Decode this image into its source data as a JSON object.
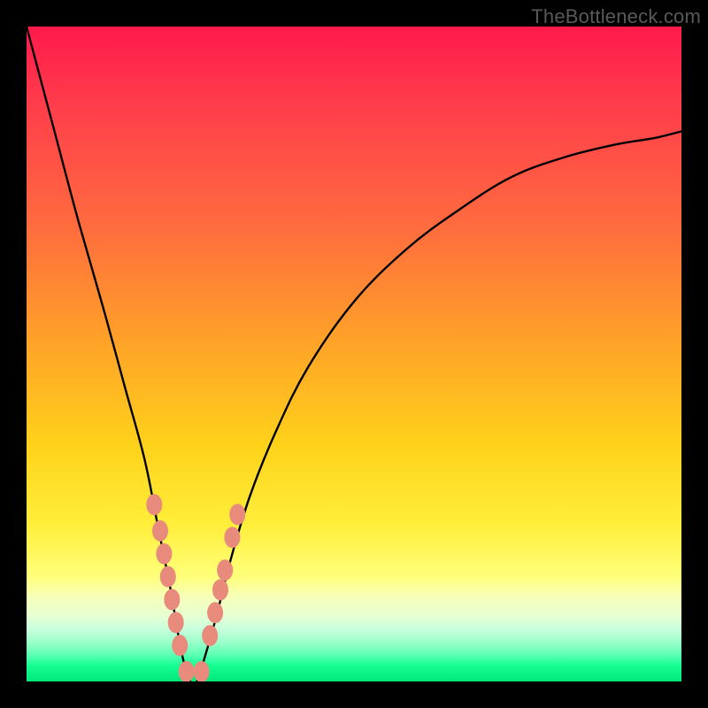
{
  "watermark": {
    "text": "TheBottleneck.com"
  },
  "chart_data": {
    "type": "line",
    "title": "",
    "xlabel": "",
    "ylabel": "",
    "xlim": [
      0,
      100
    ],
    "ylim": [
      0,
      100
    ],
    "series": [
      {
        "name": "bottleneck-curve",
        "x": [
          0,
          4,
          8,
          12,
          15,
          18,
          20,
          22,
          23,
          24,
          25,
          26,
          27,
          29,
          31,
          34,
          38,
          43,
          50,
          58,
          66,
          74,
          82,
          90,
          96,
          100
        ],
        "values": [
          100,
          85,
          70,
          56,
          45,
          34,
          24,
          14,
          8,
          3,
          0,
          0,
          3,
          10,
          18,
          28,
          38,
          48,
          58,
          66,
          72,
          77,
          80,
          82,
          83,
          84
        ]
      }
    ],
    "markers": {
      "name": "highlight-points",
      "x": [
        19.5,
        20.4,
        21.0,
        21.6,
        22.2,
        22.8,
        23.4,
        24.4,
        26.7,
        28.0,
        28.8,
        29.6,
        30.3,
        31.4,
        32.2
      ],
      "values": [
        27.0,
        23.0,
        19.5,
        16.0,
        12.5,
        9.0,
        5.5,
        1.5,
        1.5,
        7.0,
        10.5,
        14.0,
        17.0,
        22.0,
        25.5
      ]
    },
    "gradient_stops": [
      {
        "pos": 0.0,
        "color": "#ff1a4b"
      },
      {
        "pos": 0.48,
        "color": "#ffa228"
      },
      {
        "pos": 0.84,
        "color": "#ffff7a"
      },
      {
        "pos": 0.97,
        "color": "#17ff94"
      },
      {
        "pos": 1.0,
        "color": "#00e87a"
      }
    ]
  }
}
